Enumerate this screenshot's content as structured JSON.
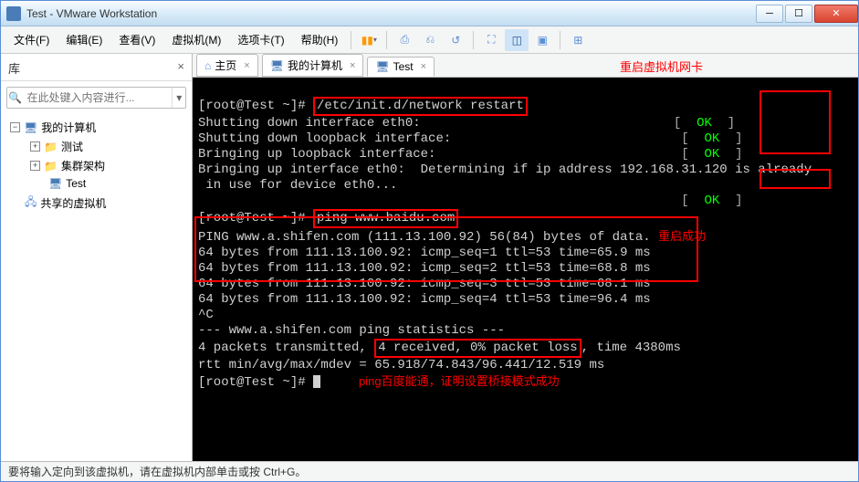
{
  "window": {
    "title": "Test - VMware Workstation"
  },
  "menu": {
    "file": "文件(F)",
    "edit": "编辑(E)",
    "view": "查看(V)",
    "vm": "虚拟机(M)",
    "tabs": "选项卡(T)",
    "help": "帮助(H)"
  },
  "sidebar": {
    "header": "库",
    "search_placeholder": "在此处键入内容进行...",
    "root": "我的计算机",
    "nodes": {
      "n1": "测试",
      "n2": "集群架构",
      "n3": "Test",
      "shared": "共享的虚拟机"
    }
  },
  "tabs": {
    "home": "主页",
    "mypc": "我的计算机",
    "test": "Test"
  },
  "annot": {
    "restart": "重启虚拟机网卡",
    "ok": "重启成功",
    "ping": "ping百度能通，证明设置桥接模式成功"
  },
  "term": {
    "prompt": "[root@Test ~]# ",
    "cmd1": "/etc/init.d/network restart",
    "l1": "Shutting down interface eth0:",
    "l2": "Shutting down loopback interface:",
    "l3": "Bringing up loopback interface:",
    "l4a": "Bringing up interface eth0:  Determining if ip address 192.168.31.120 is already",
    "l4b": " in use for device eth0...",
    "ok": "OK",
    "cmd2": "ping www.baidu.com",
    "pinghead": "PING www.a.shifen.com (111.13.100.92) 56(84) bytes of data.",
    "p1": "64 bytes from 111.13.100.92: icmp_seq=1 ttl=53 time=65.9 ms",
    "p2": "64 bytes from 111.13.100.92: icmp_seq=2 ttl=53 time=68.8 ms",
    "p3": "64 bytes from 111.13.100.92: icmp_seq=3 ttl=53 time=68.1 ms",
    "p4": "64 bytes from 111.13.100.92: icmp_seq=4 ttl=53 time=96.4 ms",
    "ctrlc": "^C",
    "stathdr": "--- www.a.shifen.com ping statistics ---",
    "stat1a": "4 packets transmitted, ",
    "stat1b": "4 received, 0% packet loss",
    "stat1c": ", time 4380ms",
    "stat2": "rtt min/avg/max/mdev = 65.918/74.843/96.441/12.519 ms"
  },
  "status": "要将输入定向到该虚拟机，请在虚拟机内部单击或按 Ctrl+G。"
}
